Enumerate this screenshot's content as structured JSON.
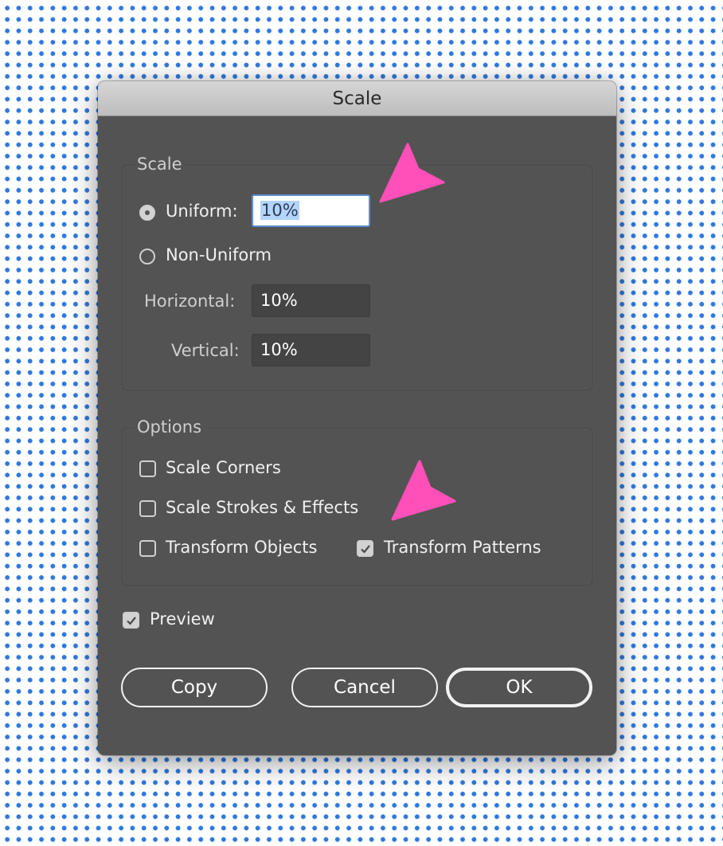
{
  "dialog": {
    "title": "Scale",
    "scale_group": {
      "label": "Scale",
      "uniform": {
        "label": "Uniform:",
        "selected": true,
        "value": "10%"
      },
      "non_uniform": {
        "label": "Non-Uniform",
        "selected": false
      },
      "horizontal": {
        "label": "Horizontal:",
        "value": "10%"
      },
      "vertical": {
        "label": "Vertical:",
        "value": "10%"
      }
    },
    "options_group": {
      "label": "Options",
      "scale_corners": {
        "label": "Scale Corners",
        "checked": false
      },
      "scale_strokes": {
        "label": "Scale Strokes & Effects",
        "checked": false
      },
      "transform_objects": {
        "label": "Transform Objects",
        "checked": false
      },
      "transform_patterns": {
        "label": "Transform Patterns",
        "checked": true
      }
    },
    "preview": {
      "label": "Preview",
      "checked": true
    },
    "buttons": {
      "copy": "Copy",
      "cancel": "Cancel",
      "ok": "OK"
    }
  },
  "annotations": {
    "arrow_color": "#ff4fb8",
    "count": 2
  },
  "colors": {
    "background_dots": "#2f78de",
    "dialog_body": "#535353",
    "focus_ring": "#5b8fd1",
    "selection": "#b3d4fc"
  }
}
